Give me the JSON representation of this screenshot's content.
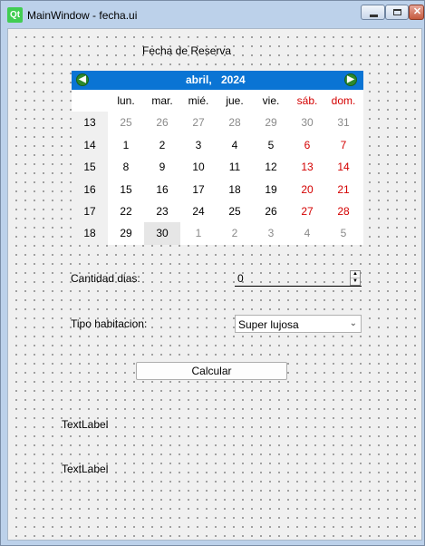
{
  "window": {
    "title": "MainWindow - fecha.ui"
  },
  "form": {
    "reserva_label": "Fecha de Reserva",
    "cantidad_label": "Cantidad dias:",
    "cantidad_value": "0",
    "tipo_label": "Tipo habitacion:",
    "tipo_value": "Super lujosa",
    "calcular_label": "Calcular",
    "text_label_1": "TextLabel",
    "text_label_2": "TextLabel"
  },
  "calendar": {
    "month": "abril,",
    "year": "2024",
    "weekdays": [
      "lun.",
      "mar.",
      "mié.",
      "jue.",
      "vie.",
      "sáb.",
      "dom."
    ],
    "weeks": [
      {
        "num": "13",
        "days": [
          "25",
          "26",
          "27",
          "28",
          "29",
          "30",
          "31"
        ]
      },
      {
        "num": "14",
        "days": [
          "1",
          "2",
          "3",
          "4",
          "5",
          "6",
          "7"
        ]
      },
      {
        "num": "15",
        "days": [
          "8",
          "9",
          "10",
          "11",
          "12",
          "13",
          "14"
        ]
      },
      {
        "num": "16",
        "days": [
          "15",
          "16",
          "17",
          "18",
          "19",
          "20",
          "21"
        ]
      },
      {
        "num": "17",
        "days": [
          "22",
          "23",
          "24",
          "25",
          "26",
          "27",
          "28"
        ]
      },
      {
        "num": "18",
        "days": [
          "29",
          "30",
          "1",
          "2",
          "3",
          "4",
          "5"
        ]
      }
    ],
    "selected": "30",
    "colors": {
      "header": "#0a74d4",
      "weekend": "#d40000",
      "other_month": "#8a8a8a"
    }
  }
}
